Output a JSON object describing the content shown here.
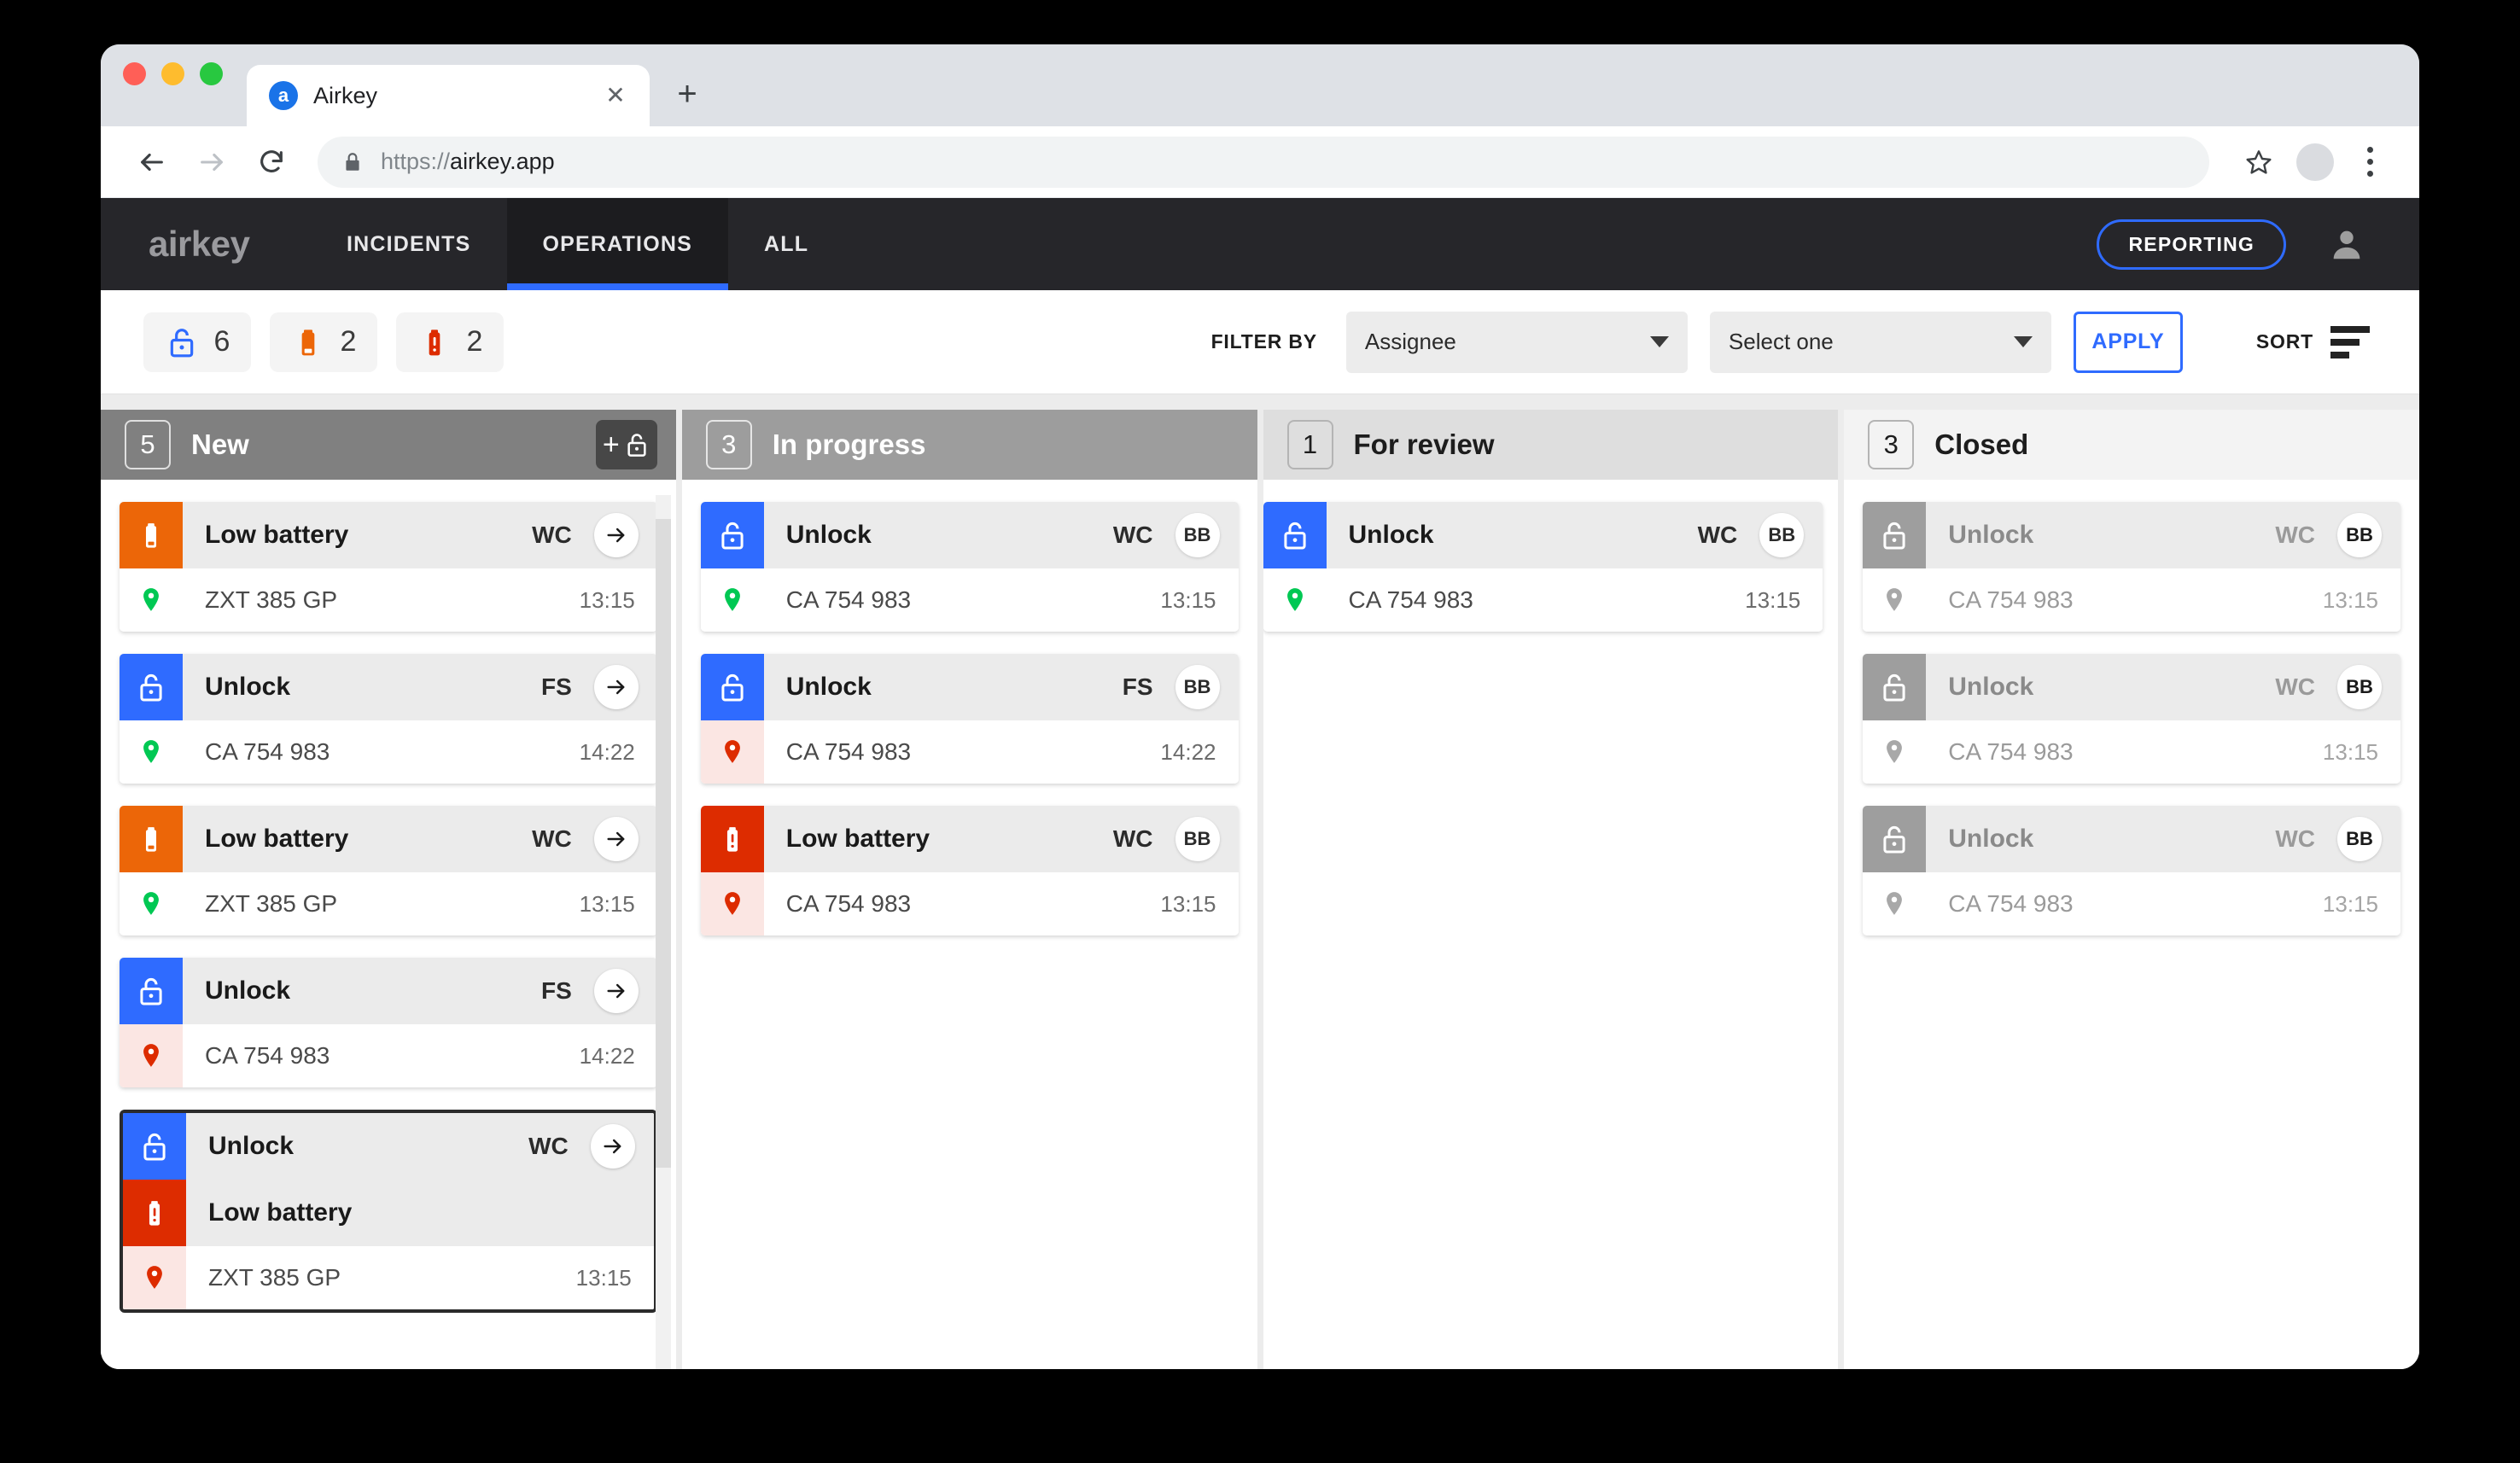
{
  "browser": {
    "tab": {
      "title": "Airkey",
      "favicon_letter": "a",
      "close_label": "✕"
    },
    "new_tab_label": "+",
    "url_scheme": "https://",
    "url_host": "airkey.app"
  },
  "app_header": {
    "brand": "airkey",
    "nav": [
      {
        "label": "INCIDENTS",
        "active": false
      },
      {
        "label": "OPERATIONS",
        "active": true
      },
      {
        "label": "ALL",
        "active": false
      }
    ],
    "reporting_label": "REPORTING"
  },
  "filterbar": {
    "stats": [
      {
        "icon": "unlock-icon",
        "color": "#2f6bff",
        "count": "6"
      },
      {
        "icon": "battery-low-icon",
        "color": "#ec6608",
        "count": "2"
      },
      {
        "icon": "battery-alert-icon",
        "color": "#dd2c00",
        "count": "2"
      }
    ],
    "filter_label": "FILTER BY",
    "filter_field": "Assignee",
    "filter_value": "Select one",
    "apply_label": "APPLY",
    "sort_label": "SORT"
  },
  "board": {
    "columns": [
      {
        "count": "5",
        "title": "New",
        "tone": "tone-0",
        "has_add": true,
        "add_label": "+",
        "cards": [
          {
            "rows": [
              {
                "icon": "battery-low-icon",
                "tile": "orange",
                "title": "Low battery",
                "initials": "WC",
                "action": "arrow"
              }
            ],
            "foot": {
              "pin": "green",
              "text": "ZXT 385 GP",
              "time": "13:15",
              "tint": false
            }
          },
          {
            "rows": [
              {
                "icon": "unlock-icon",
                "tile": "blue",
                "title": "Unlock",
                "initials": "FS",
                "action": "arrow"
              }
            ],
            "foot": {
              "pin": "green",
              "text": "CA 754 983",
              "time": "14:22",
              "tint": false
            }
          },
          {
            "rows": [
              {
                "icon": "battery-low-icon",
                "tile": "orange",
                "title": "Low battery",
                "initials": "WC",
                "action": "arrow"
              }
            ],
            "foot": {
              "pin": "green",
              "text": "ZXT 385 GP",
              "time": "13:15",
              "tint": false
            }
          },
          {
            "rows": [
              {
                "icon": "unlock-icon",
                "tile": "blue",
                "title": "Unlock",
                "initials": "FS",
                "action": "arrow"
              }
            ],
            "foot": {
              "pin": "red",
              "text": "CA 754 983",
              "time": "14:22",
              "tint": true
            }
          },
          {
            "selected": true,
            "rows": [
              {
                "icon": "unlock-icon",
                "tile": "blue",
                "title": "Unlock",
                "initials": "WC",
                "action": "arrow"
              },
              {
                "icon": "battery-alert-icon",
                "tile": "red",
                "title": "Low battery",
                "initials": "",
                "action": "none"
              }
            ],
            "foot": {
              "pin": "red",
              "text": "ZXT 385 GP",
              "time": "13:15",
              "tint": true
            }
          }
        ]
      },
      {
        "count": "3",
        "title": "In progress",
        "tone": "tone-1",
        "has_add": false,
        "cards": [
          {
            "rows": [
              {
                "icon": "unlock-icon",
                "tile": "blue",
                "title": "Unlock",
                "initials": "WC",
                "action": "avatar",
                "avatar": "BB"
              }
            ],
            "foot": {
              "pin": "green",
              "text": "CA 754 983",
              "time": "13:15",
              "tint": false
            }
          },
          {
            "rows": [
              {
                "icon": "unlock-icon",
                "tile": "blue",
                "title": "Unlock",
                "initials": "FS",
                "action": "avatar",
                "avatar": "BB"
              }
            ],
            "foot": {
              "pin": "red",
              "text": "CA 754 983",
              "time": "14:22",
              "tint": true
            }
          },
          {
            "rows": [
              {
                "icon": "battery-alert-icon",
                "tile": "red",
                "title": "Low battery",
                "initials": "WC",
                "action": "avatar",
                "avatar": "BB"
              }
            ],
            "foot": {
              "pin": "red",
              "text": "CA 754 983",
              "time": "13:15",
              "tint": true
            }
          }
        ]
      },
      {
        "count": "1",
        "title": "For review",
        "tone": "tone-2",
        "has_add": false,
        "flush": true,
        "cards": [
          {
            "rows": [
              {
                "icon": "unlock-icon",
                "tile": "blue",
                "title": "Unlock",
                "initials": "WC",
                "action": "avatar",
                "avatar": "BB"
              }
            ],
            "foot": {
              "pin": "green",
              "text": "CA 754 983",
              "time": "13:15",
              "tint": false
            }
          }
        ]
      },
      {
        "count": "3",
        "title": "Closed",
        "tone": "tone-3",
        "has_add": false,
        "cards": [
          {
            "muted": true,
            "rows": [
              {
                "icon": "unlock-icon",
                "tile": "gray",
                "title": "Unlock",
                "initials": "WC",
                "action": "avatar",
                "avatar": "BB"
              }
            ],
            "foot": {
              "pin": "gray",
              "text": "CA 754 983",
              "time": "13:15",
              "tint": false
            }
          },
          {
            "muted": true,
            "rows": [
              {
                "icon": "unlock-icon",
                "tile": "gray",
                "title": "Unlock",
                "initials": "WC",
                "action": "avatar",
                "avatar": "BB"
              }
            ],
            "foot": {
              "pin": "gray",
              "text": "CA 754 983",
              "time": "13:15",
              "tint": false
            }
          },
          {
            "muted": true,
            "rows": [
              {
                "icon": "unlock-icon",
                "tile": "gray",
                "title": "Unlock",
                "initials": "WC",
                "action": "avatar",
                "avatar": "BB"
              }
            ],
            "foot": {
              "pin": "gray",
              "text": "CA 754 983",
              "time": "13:15",
              "tint": false
            }
          }
        ]
      }
    ]
  }
}
